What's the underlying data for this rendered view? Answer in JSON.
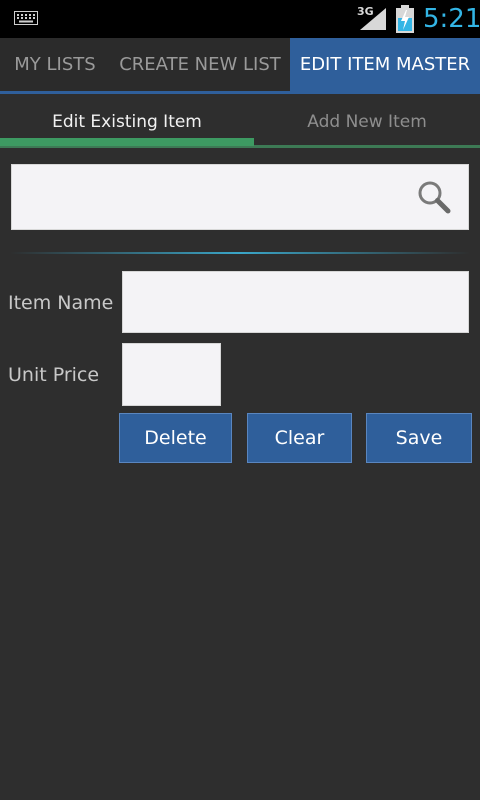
{
  "status_bar": {
    "network": "3G",
    "time": "5:21",
    "icons": [
      "keyboard-icon",
      "signal-icon",
      "battery-charging-icon"
    ]
  },
  "action_tabs": [
    {
      "label": "MY LISTS"
    },
    {
      "label": "CREATE NEW LIST"
    },
    {
      "label": "EDIT ITEM MASTER",
      "selected": true
    }
  ],
  "sub_tabs": [
    {
      "label": "Edit Existing Item",
      "selected": true
    },
    {
      "label": "Add New Item"
    }
  ],
  "search": {
    "value": "",
    "icon": "search-icon"
  },
  "form": {
    "item_name_label": "Item Name",
    "item_name_value": "",
    "unit_price_label": "Unit Price",
    "unit_price_value": ""
  },
  "buttons": {
    "delete": "Delete",
    "clear": "Clear",
    "save": "Save"
  },
  "colors": {
    "accent_blue": "#2f5f9b",
    "tab_indicator_green": "#3d9a62",
    "clock_blue": "#33b5e5"
  }
}
